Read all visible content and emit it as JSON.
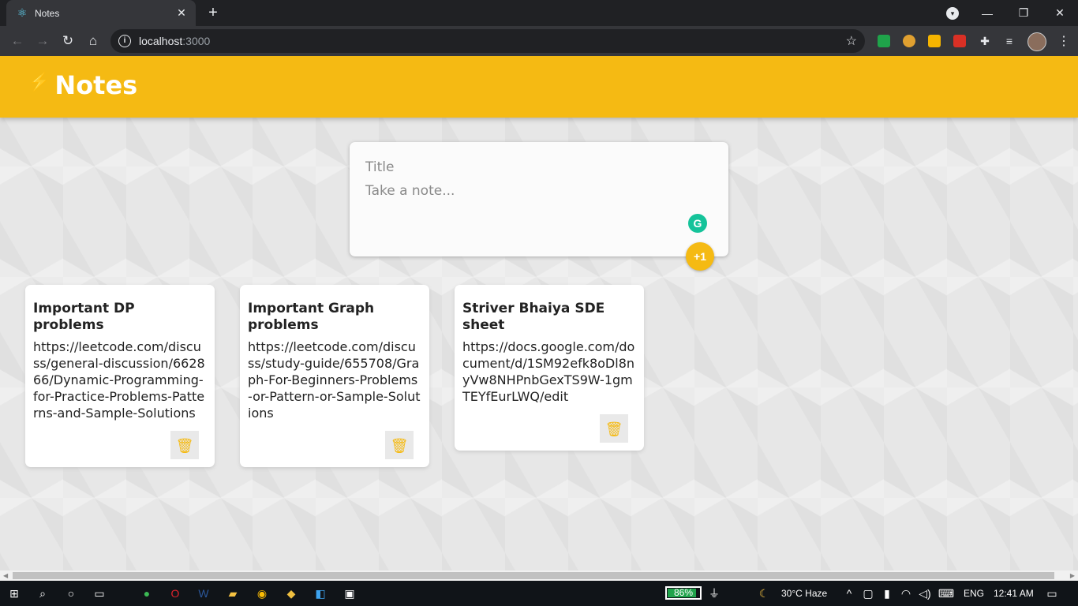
{
  "browser": {
    "tab_title": "Notes",
    "close_tab": "✕",
    "new_tab": "+",
    "url_host": "localhost",
    "url_port": ":3000",
    "window_controls": {
      "minimize": "—",
      "restore": "❐",
      "close": "✕"
    }
  },
  "app": {
    "brand": "Notes",
    "bolt_icon": "⚡",
    "create_note": {
      "title_placeholder": "Title",
      "content_placeholder": "Take a note...",
      "add_label": "+1",
      "grammarly_label": "G"
    },
    "notes": [
      {
        "title": "Important DP problems",
        "content": "https://leetcode.com/discuss/general-discussion/662866/Dynamic-Programming-for-Practice-Problems-Patterns-and-Sample-Solutions"
      },
      {
        "title": "Important Graph problems",
        "content": "https://leetcode.com/discuss/study-guide/655708/Graph-For-Beginners-Problems-or-Pattern-or-Sample-Solutions"
      },
      {
        "title": "Striver Bhaiya SDE sheet",
        "content": "https://docs.google.com/document/d/1SM92efk8oDl8nyVw8NHPnbGexTS9W-1gmTEYfEurLWQ/edit"
      }
    ],
    "delete_icon": "🗑"
  },
  "taskbar": {
    "battery": "86%",
    "weather": "30°C  Haze",
    "language": "ENG",
    "time": "12:41 AM"
  },
  "colors": {
    "accent": "#f5ba13",
    "chrome_dark": "#202124",
    "chrome_toolbar": "#35363a"
  }
}
